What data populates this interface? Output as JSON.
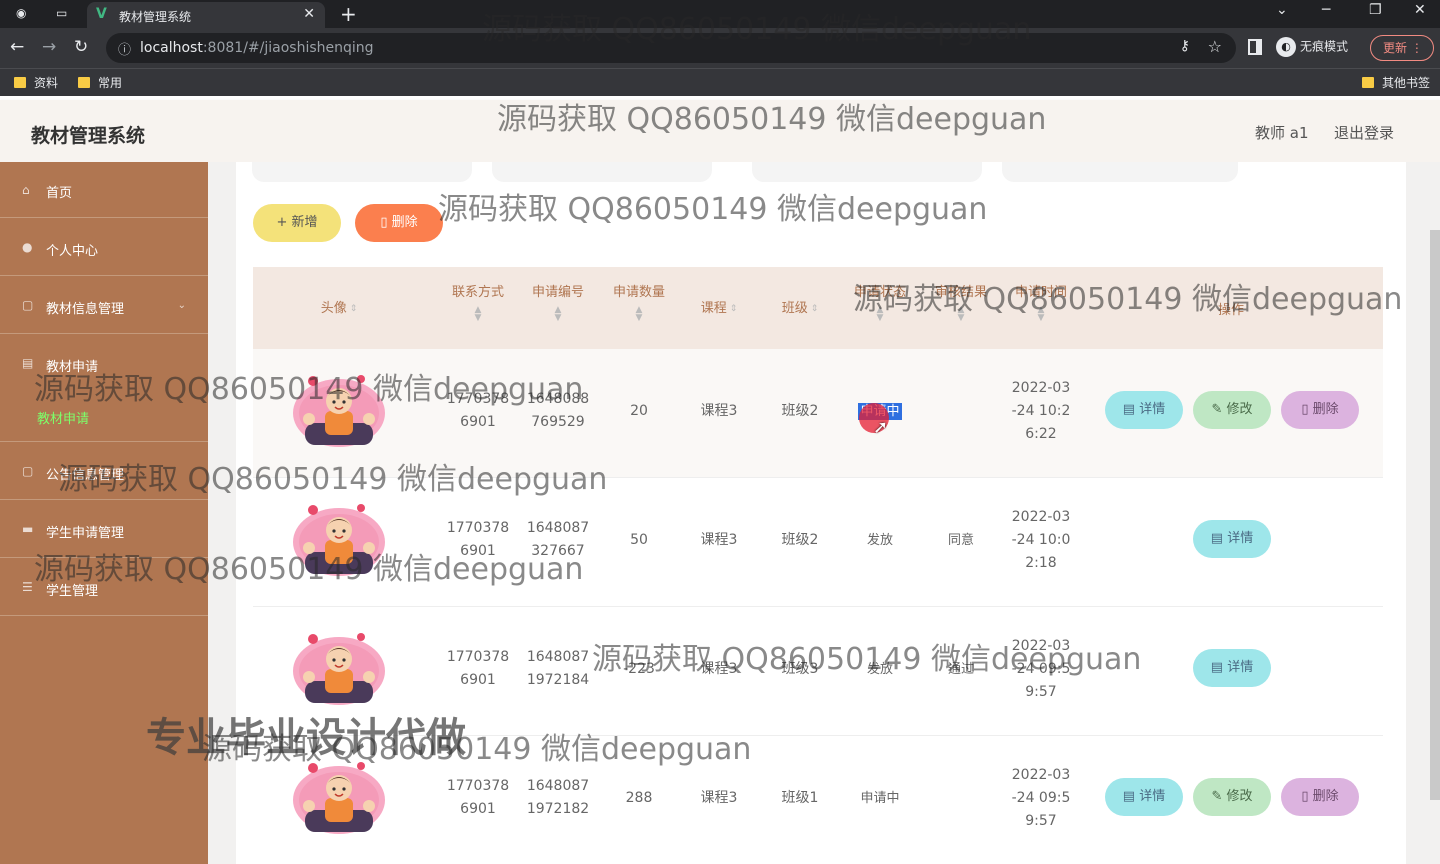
{
  "browser": {
    "tab_title": "教材管理系统",
    "url_host": "localhost",
    "url_path": ":8081/#/jiaoshishenqing",
    "incognito_label": "无痕模式",
    "update_label": "更新",
    "bookmarks": [
      "资料",
      "常用"
    ],
    "other_bookmarks": "其他书签"
  },
  "app": {
    "title": "教材管理系统",
    "user": "教师 a1",
    "logout": "退出登录"
  },
  "sidebar": {
    "items": [
      {
        "label": "首页"
      },
      {
        "label": "个人中心"
      },
      {
        "label": "教材信息管理"
      },
      {
        "label": "教材申请"
      },
      {
        "label": "公告信息管理"
      },
      {
        "label": "学生申请管理"
      },
      {
        "label": "学生管理"
      }
    ],
    "active_sub": "教材申请"
  },
  "actions": {
    "add": "+ 新增",
    "delete": "删除"
  },
  "table": {
    "headers": [
      "头像",
      "联系方式",
      "申请编号",
      "申请数量",
      "课程",
      "班级",
      "申请状态",
      "审核结果",
      "申请时间",
      "操作"
    ],
    "rows": [
      {
        "phone": [
          "1770378",
          "6901"
        ],
        "code": [
          "1648088",
          "769529"
        ],
        "qty": "20",
        "course": "课程3",
        "class": "班级2",
        "status": "申请中",
        "result": "",
        "time": [
          "2022-03",
          "-24 10:2",
          "6:22"
        ]
      },
      {
        "phone": [
          "1770378",
          "6901"
        ],
        "code": [
          "1648087",
          "327667"
        ],
        "qty": "50",
        "course": "课程3",
        "class": "班级2",
        "status": "发放",
        "result": "同意",
        "time": [
          "2022-03",
          "-24 10:0",
          "2:18"
        ]
      },
      {
        "phone": [
          "1770378",
          "6901"
        ],
        "code": [
          "1648087",
          "1972184"
        ],
        "qty": "-223",
        "course": "课程3",
        "class": "班级3",
        "status": "发放",
        "result": "通过",
        "time": [
          "2022-03",
          "-24 09:5",
          "9:57"
        ]
      },
      {
        "phone": [
          "1770378",
          "6901"
        ],
        "code": [
          "1648087",
          "1972182"
        ],
        "qty": "288",
        "course": "课程3",
        "class": "班级1",
        "status": "申请中",
        "result": "",
        "time": [
          "2022-03",
          "-24 09:5",
          "9:57"
        ]
      }
    ],
    "op_labels": {
      "detail": "详情",
      "edit": "修改",
      "delete": "删除"
    }
  },
  "watermark": "源码获取 QQ86050149 微信deepguan",
  "promo": "专业毕业设计代做"
}
